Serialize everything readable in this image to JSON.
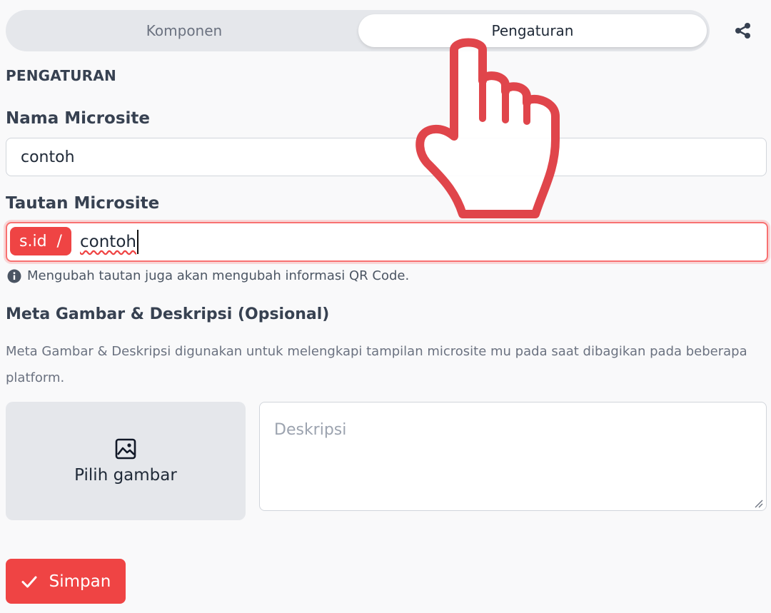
{
  "tabs": {
    "components_label": "Komponen",
    "settings_label": "Pengaturan",
    "active": "Pengaturan"
  },
  "settings": {
    "section_heading": "PENGATURAN",
    "name_label": "Nama Microsite",
    "name_value": "contoh",
    "link_label": "Tautan Microsite",
    "link_prefix": "s.id  /",
    "link_value": "contoh",
    "link_info": "Mengubah tautan juga akan mengubah informasi QR Code.",
    "meta_heading": "Meta Gambar & Deskripsi (Opsional)",
    "meta_description": "Meta Gambar & Deskripsi digunakan untuk melengkapi tampilan microsite mu pada saat dibagikan pada beberapa platform.",
    "pick_image_label": "Pilih gambar",
    "description_placeholder": "Deskripsi",
    "save_label": "Simpan"
  },
  "colors": {
    "accent": "#ef4444",
    "tab_bar": "#e5e7eb",
    "text": "#374151"
  },
  "icons": [
    "share-icon",
    "info-icon",
    "image-icon",
    "check-icon",
    "hand-cursor-icon",
    "resize-handle-icon"
  ]
}
